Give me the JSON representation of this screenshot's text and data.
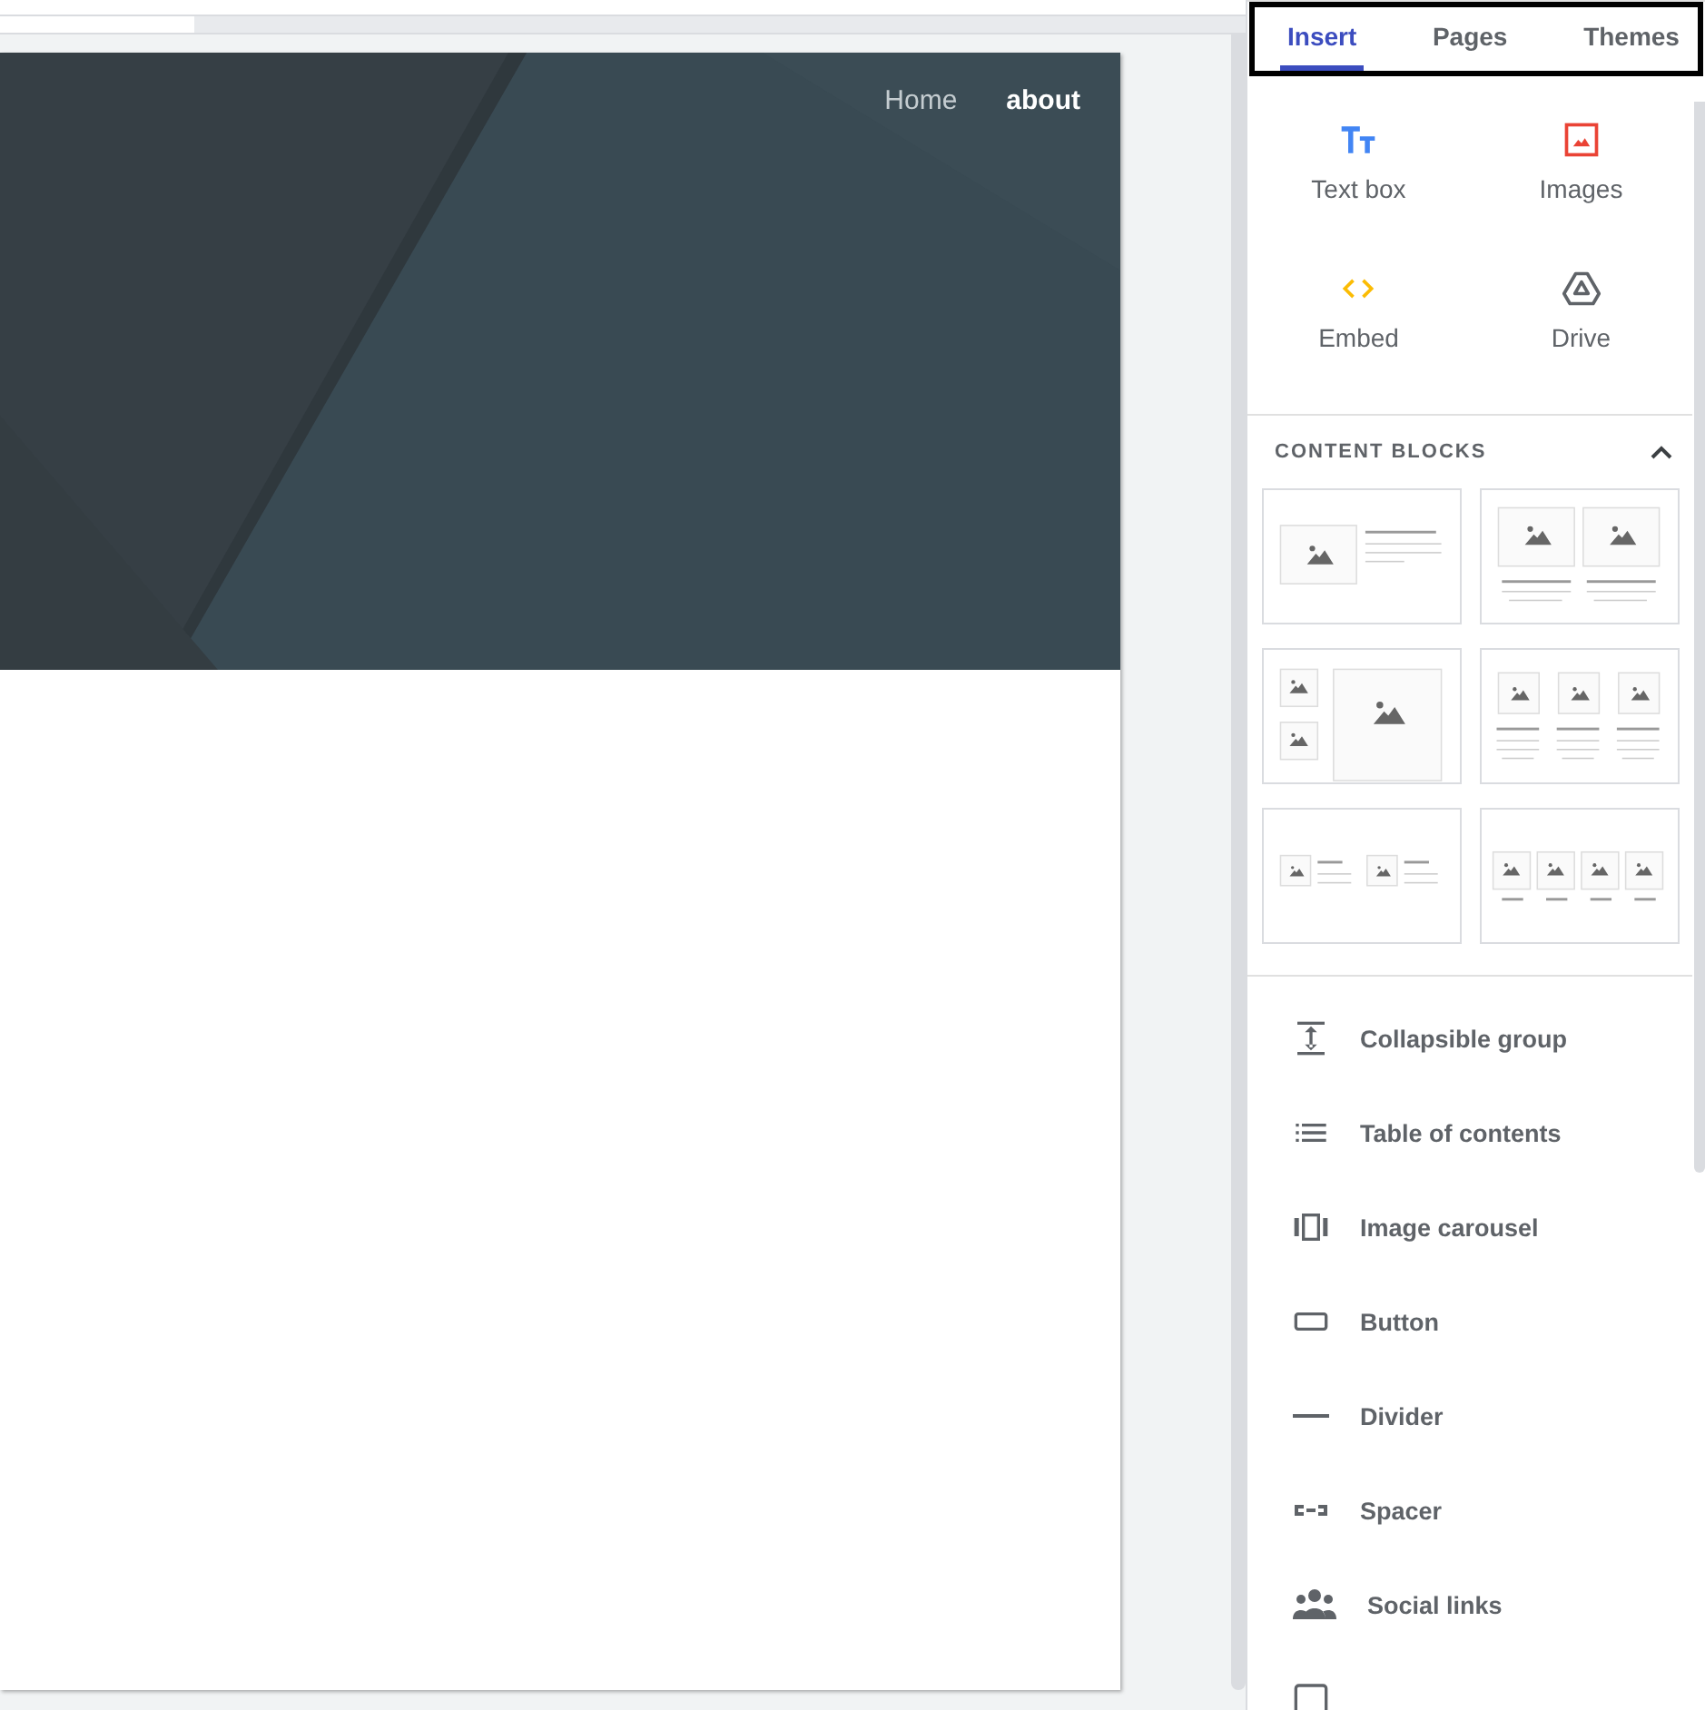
{
  "site_nav": [
    {
      "label": "Home",
      "selected": false
    },
    {
      "label": "about",
      "selected": true
    }
  ],
  "tabs": [
    {
      "label": "Insert",
      "selected": true
    },
    {
      "label": "Pages",
      "selected": false
    },
    {
      "label": "Themes",
      "selected": false
    }
  ],
  "insert_items": [
    {
      "kind": "textbox",
      "label": "Text box"
    },
    {
      "kind": "images",
      "label": "Images"
    },
    {
      "kind": "embed",
      "label": "Embed"
    },
    {
      "kind": "drive",
      "label": "Drive"
    }
  ],
  "content_blocks": {
    "title": "CONTENT BLOCKS",
    "expanded": true,
    "layouts": [
      {
        "kind": "split"
      },
      {
        "kind": "pair"
      },
      {
        "kind": "mosaic"
      },
      {
        "kind": "trio"
      },
      {
        "kind": "compact"
      },
      {
        "kind": "quad"
      }
    ]
  },
  "components": [
    {
      "kind": "collapsible",
      "label": "Collapsible group"
    },
    {
      "kind": "toc",
      "label": "Table of contents"
    },
    {
      "kind": "carousel",
      "label": "Image carousel"
    },
    {
      "kind": "button",
      "label": "Button"
    },
    {
      "kind": "divider",
      "label": "Divider"
    },
    {
      "kind": "spacer",
      "label": "Spacer"
    },
    {
      "kind": "social",
      "label": "Social links"
    },
    {
      "kind": "frame"
    }
  ]
}
